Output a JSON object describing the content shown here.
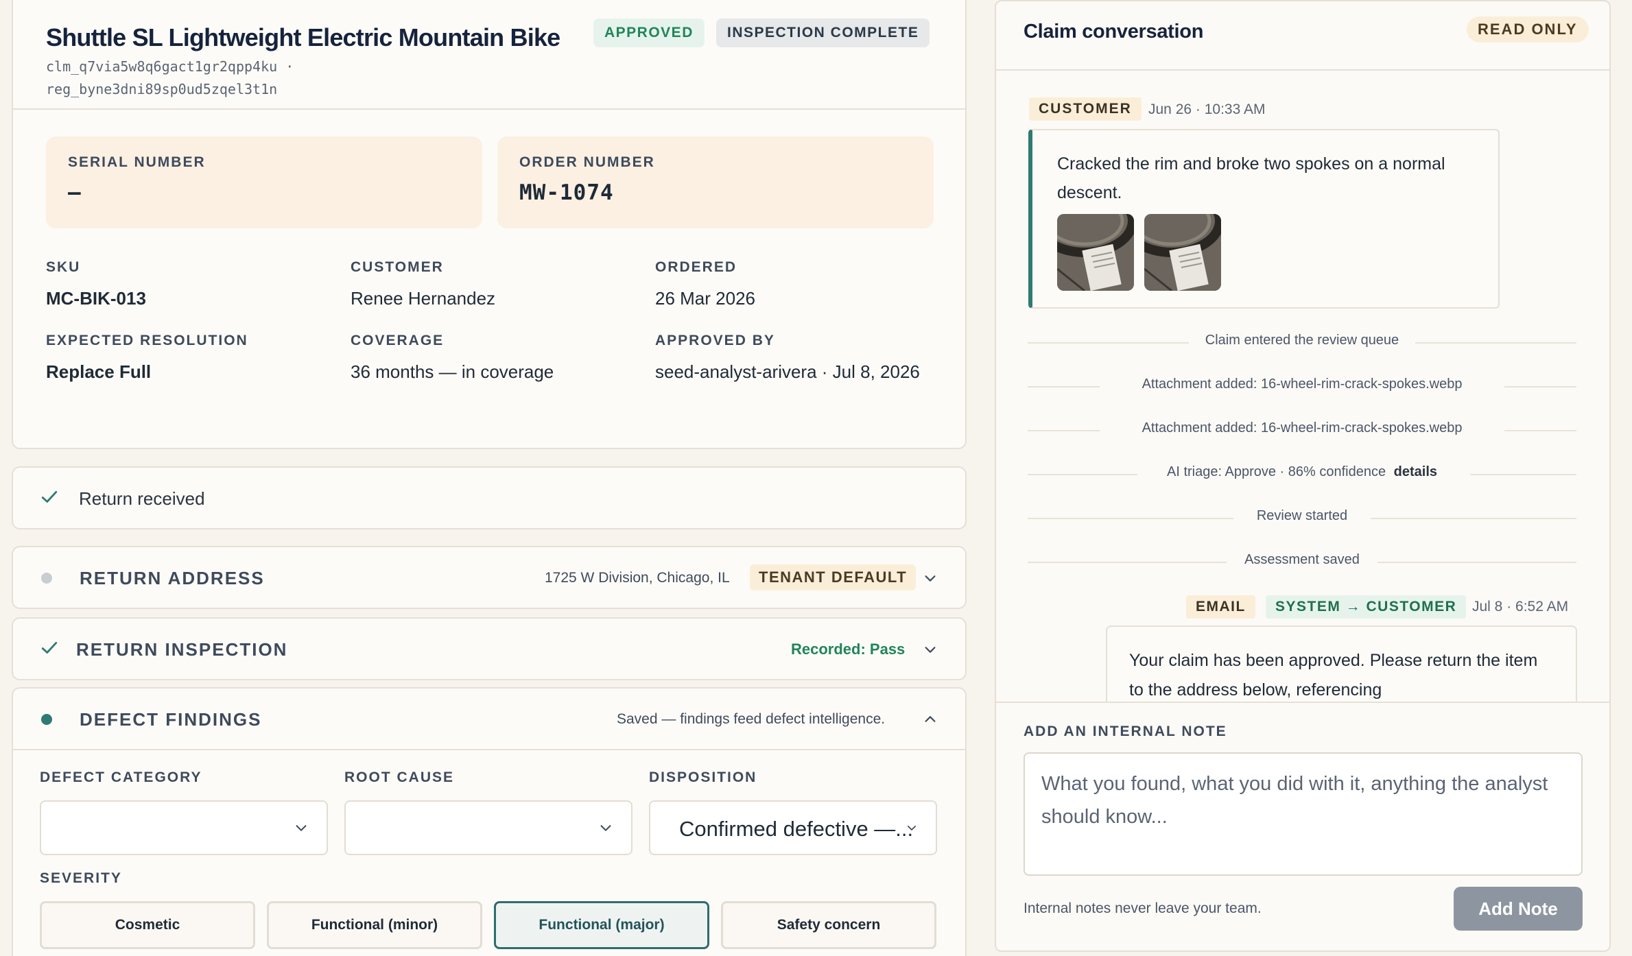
{
  "claim": {
    "title": "Shuttle SL Lightweight Electric Mountain Bike",
    "ids_line1": "clm_q7via5w8q6gact1gr2qpp4ku ·",
    "ids_line2": "reg_byne3dni89sp0ud5zqel3t1n",
    "badges": {
      "approved": "APPROVED",
      "inspection": "INSPECTION COMPLETE"
    },
    "tiles": {
      "serial": {
        "label": "SERIAL NUMBER",
        "value": "—"
      },
      "order": {
        "label": "ORDER NUMBER",
        "value": "MW-1074"
      }
    },
    "fields": {
      "sku": {
        "label": "SKU",
        "value": "MC-BIK-013"
      },
      "customer": {
        "label": "CUSTOMER",
        "value": "Renee Hernandez"
      },
      "ordered": {
        "label": "ORDERED",
        "value": "26 Mar 2026"
      },
      "resolution": {
        "label": "EXPECTED RESOLUTION",
        "value": "Replace Full"
      },
      "coverage": {
        "label": "COVERAGE",
        "value": "36 months — in coverage"
      },
      "approved_by": {
        "label": "APPROVED BY",
        "value": "seed-analyst-arivera · Jul 8, 2026"
      }
    }
  },
  "steps": {
    "return_received": {
      "label": "Return received"
    },
    "return_address": {
      "label": "RETURN ADDRESS",
      "address": "1725 W Division, Chicago, IL",
      "tag": "TENANT DEFAULT"
    },
    "return_inspection": {
      "label": "RETURN INSPECTION",
      "status": "Recorded: Pass"
    },
    "defect_findings": {
      "label": "DEFECT FINDINGS",
      "status": "Saved — findings feed defect intelligence.",
      "category_label": "DEFECT CATEGORY",
      "category_value": "",
      "root_cause_label": "ROOT CAUSE",
      "root_cause_value": "",
      "disposition_label": "DISPOSITION",
      "disposition_value": "Confirmed defective —...",
      "severity_label": "SEVERITY",
      "severity_options": [
        "Cosmetic",
        "Functional (minor)",
        "Functional (major)",
        "Safety concern"
      ],
      "severity_selected": "Functional (major)"
    }
  },
  "conversation": {
    "title": "Claim conversation",
    "mode": "READ ONLY",
    "customer_tag": "CUSTOMER",
    "customer_time": "Jun 26 · 10:33 AM",
    "customer_message": "Cracked the rim and broke two spokes on a normal descent.",
    "events": [
      "Claim entered the review queue",
      "Attachment added: 16-wheel-rim-crack-spokes.webp",
      "Attachment added: 16-wheel-rim-crack-spokes.webp",
      "AI triage: Approve · 86% confidence",
      "Review started",
      "Assessment saved"
    ],
    "event_details_link": "details",
    "email_tag": "EMAIL",
    "direction_tag": "SYSTEM → CUSTOMER",
    "email_time": "Jul 8 · 6:52 AM",
    "email_message": "Your claim has been approved. Please return the item to the address below, referencing"
  },
  "composer": {
    "label": "ADD AN INTERNAL NOTE",
    "placeholder": "What you found, what you did with it, anything the analyst should know...",
    "value": "",
    "footer": "Internal notes never leave your team.",
    "button": "Add Note"
  },
  "colors": {
    "accent": "#2f7a72",
    "approved": "#20855a",
    "page_bg": "#f7f4ee",
    "tile_bg": "#fbf0e2"
  }
}
